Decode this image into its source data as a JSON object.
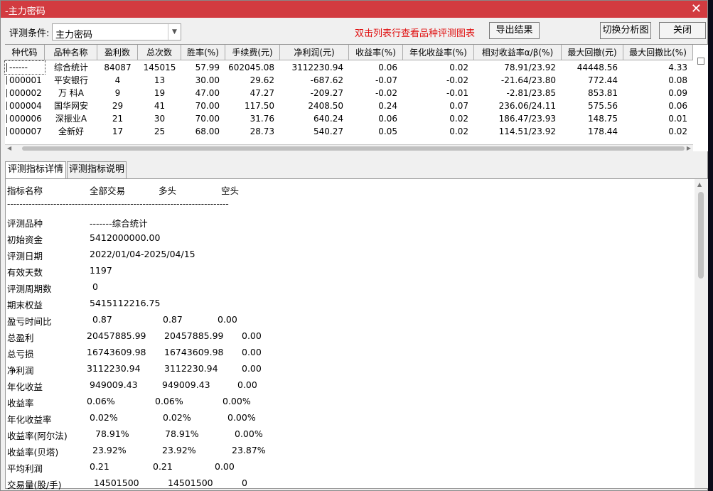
{
  "window": {
    "title": "-主力密码",
    "close_glyph": "✕"
  },
  "toolbar": {
    "condition_label": "评测条件:",
    "condition_value": "主力密码",
    "hint": "双击列表行查看品种评测图表",
    "export_label": "导出结果",
    "switch_label": "切换分析图",
    "close_label": "关闭"
  },
  "table": {
    "headers": [
      "种代码",
      "品种名称",
      "盈利数",
      "总次数",
      "胜率(%)",
      "手续费(元)",
      "净利润(元)",
      "收益率(%)",
      "年化收益率(%)",
      "相对收益率α/β(%)",
      "最大回撤(元)",
      "最大回撤比(%)"
    ],
    "rows": [
      [
        "------",
        "综合统计",
        "84087",
        "145015",
        "57.99",
        "602045.08",
        "3112230.94",
        "0.06",
        "0.02",
        "78.91/23.92",
        "44448.56",
        "4.33"
      ],
      [
        "000001",
        "平安银行",
        "4",
        "13",
        "30.00",
        "29.62",
        "-687.62",
        "-0.07",
        "-0.02",
        "-21.64/23.80",
        "772.44",
        "0.08"
      ],
      [
        "000002",
        "万 科A",
        "9",
        "19",
        "47.00",
        "47.27",
        "-209.27",
        "-0.02",
        "-0.01",
        "-2.81/23.85",
        "853.81",
        "0.09"
      ],
      [
        "000004",
        "国华网安",
        "29",
        "41",
        "70.00",
        "117.50",
        "2408.50",
        "0.24",
        "0.07",
        "236.06/24.11",
        "575.56",
        "0.06"
      ],
      [
        "000006",
        "深振业A",
        "21",
        "30",
        "70.00",
        "31.76",
        "640.24",
        "0.06",
        "0.02",
        "186.47/23.93",
        "148.75",
        "0.01"
      ],
      [
        "000007",
        "全新好",
        "17",
        "25",
        "68.00",
        "28.73",
        "540.27",
        "0.05",
        "0.02",
        "114.51/23.92",
        "178.44",
        "0.02"
      ]
    ]
  },
  "tabs": [
    "评测指标详情",
    "评测指标说明"
  ],
  "detail": {
    "head": [
      "指标名称",
      "全部交易",
      "多头",
      "空头"
    ],
    "separator": "------------------------------------------------------------------------",
    "single": [
      [
        "评测品种",
        "-------综合统计"
      ],
      [
        "初始资金",
        "5412000000.00"
      ],
      [
        "评测日期",
        "2022/01/04-2025/04/15"
      ],
      [
        "有效天数",
        "1197"
      ],
      [
        "评测周期数",
        "0"
      ],
      [
        "期末权益",
        "5415112216.75"
      ]
    ],
    "triple": [
      [
        "盈亏时间比",
        "0.87",
        "0.87",
        "0.00"
      ],
      [
        "总盈利",
        "20457885.99",
        "20457885.99",
        "0.00"
      ],
      [
        "总亏损",
        "16743609.98",
        "16743609.98",
        "0.00"
      ],
      [
        "净利润",
        "3112230.94",
        "3112230.94",
        "0.00"
      ],
      [
        "年化收益",
        "949009.43",
        "949009.43",
        "0.00"
      ],
      [
        "收益率",
        "0.06%",
        "0.06%",
        "0.00%"
      ],
      [
        "年化收益率",
        "0.02%",
        "0.02%",
        "0.00%"
      ],
      [
        "收益率(阿尔法)",
        "78.91%",
        "78.91%",
        "0.00%"
      ],
      [
        "收益率(贝塔)",
        "23.92%",
        "23.92%",
        "23.87%"
      ],
      [
        "平均利润",
        "0.21",
        "0.21",
        "0.00"
      ],
      [
        "交易量(股/手)",
        "14501500",
        "14501500",
        "0"
      ]
    ]
  },
  "colors": {
    "titlebar": "#d23b40",
    "hint": "#e01010"
  }
}
